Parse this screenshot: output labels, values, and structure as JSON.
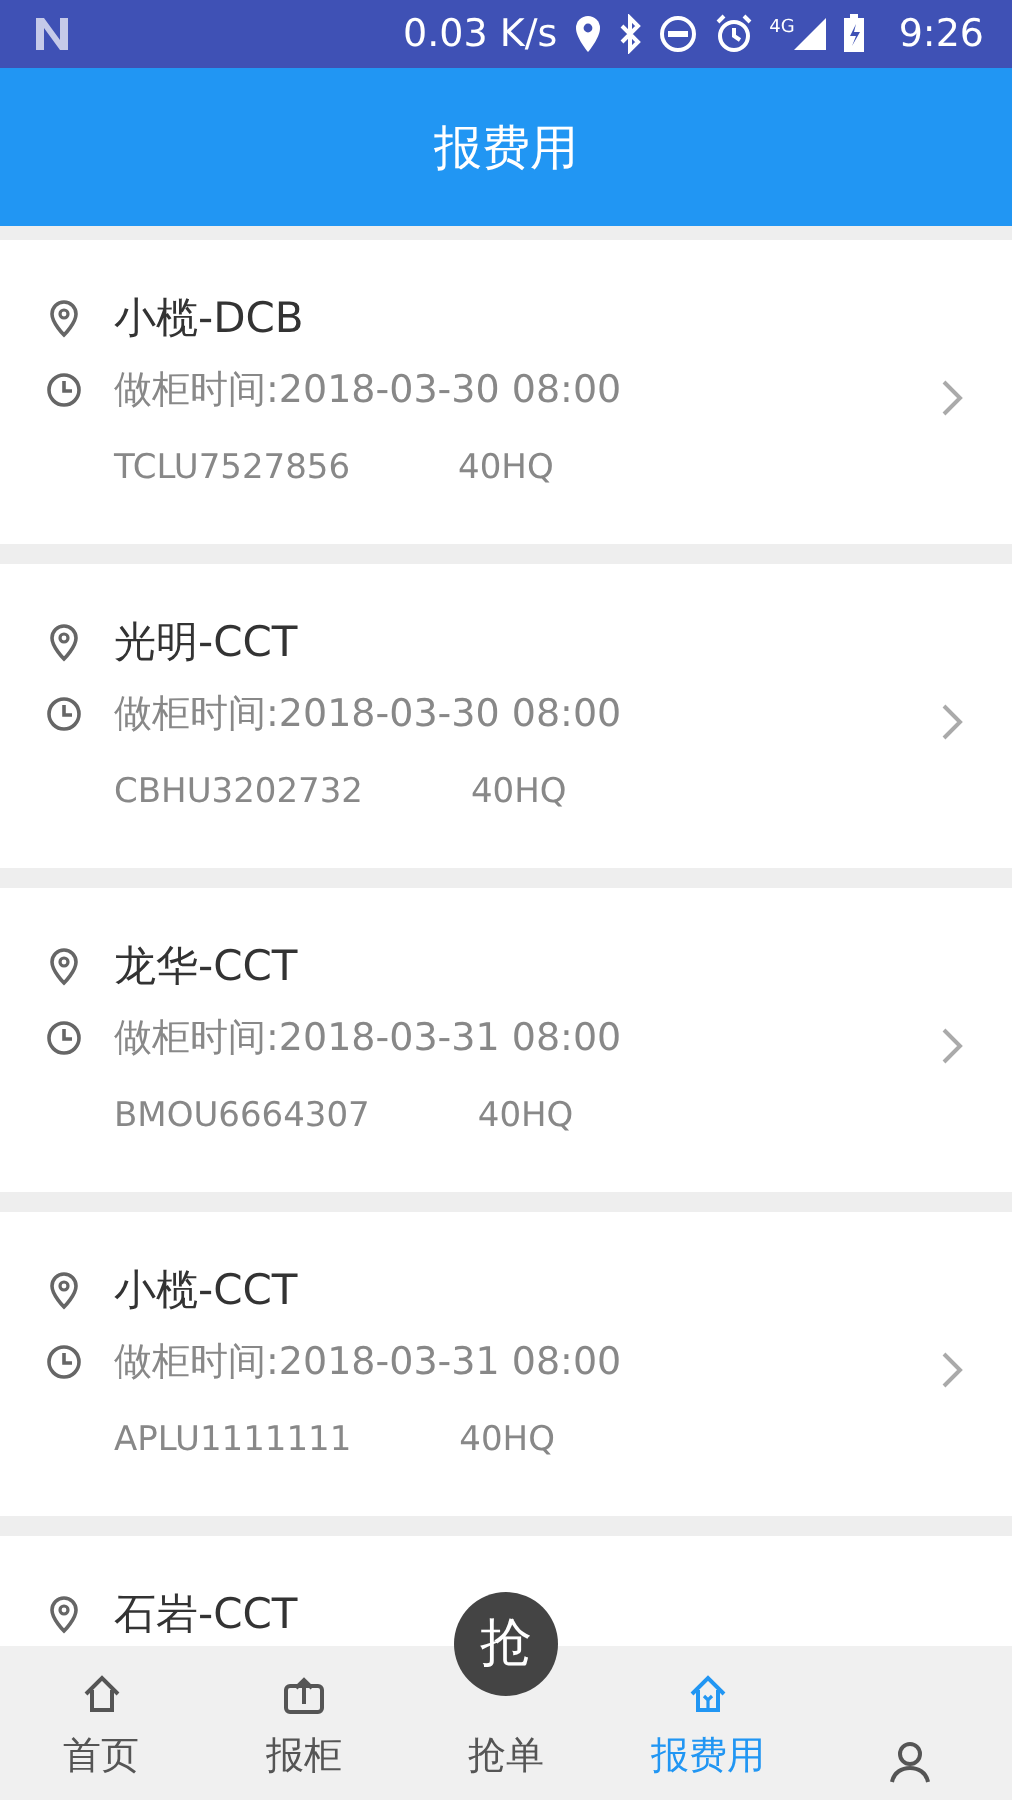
{
  "status_bar": {
    "speed": "0.03 K/s",
    "network": "4G",
    "time": "9:26"
  },
  "header": {
    "title": "报费用"
  },
  "orders": [
    {
      "place": "小榄-DCB",
      "time": "做柜时间:2018-03-30 08:00",
      "container": "TCLU7527856",
      "size": "40HQ"
    },
    {
      "place": "光明-CCT",
      "time": "做柜时间:2018-03-30 08:00",
      "container": "CBHU3202732",
      "size": "40HQ"
    },
    {
      "place": "龙华-CCT",
      "time": "做柜时间:2018-03-31 08:00",
      "container": "BMOU6664307",
      "size": "40HQ"
    },
    {
      "place": "小榄-CCT",
      "time": "做柜时间:2018-03-31 08:00",
      "container": "APLU1111111",
      "size": "40HQ"
    },
    {
      "place": "石岩-CCT"
    }
  ],
  "grab_button": {
    "label": "抢"
  },
  "tabs": [
    {
      "kind": "home",
      "label": "首页",
      "selected": false
    },
    {
      "kind": "upload",
      "label": "报柜",
      "selected": false
    },
    {
      "kind": "grab",
      "label": "抢单",
      "selected": false
    },
    {
      "kind": "fee",
      "label": "报费用",
      "selected": true
    },
    {
      "kind": "user",
      "selected": false
    }
  ]
}
